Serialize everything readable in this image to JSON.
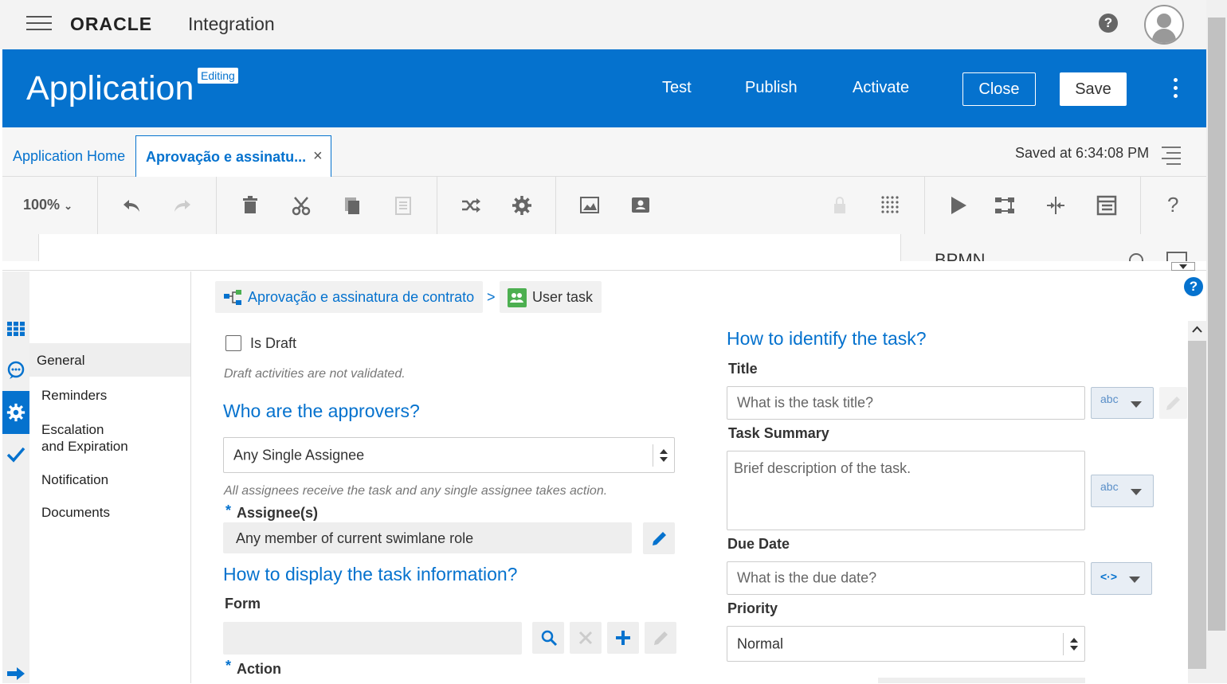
{
  "topbar": {
    "brand": "ORACLE",
    "product": "Integration",
    "help_icon": "help-circle-icon",
    "avatar_icon": "user-avatar-icon"
  },
  "header": {
    "title": "Application",
    "badge": "Editing",
    "actions": {
      "test": "Test",
      "publish": "Publish",
      "activate": "Activate",
      "close": "Close",
      "save": "Save"
    },
    "accent": "#0572ce"
  },
  "tabs": {
    "home": "Application Home",
    "active": "Aprovação e assinatu...",
    "close_glyph": "×",
    "saved_at": "Saved at 6:34:08 PM"
  },
  "toolbar": {
    "zoom": "100%",
    "icons": [
      "undo-icon",
      "redo-icon",
      "delete-icon",
      "cut-icon",
      "copy-icon",
      "paste-icon",
      "shuffle-icon",
      "gear-icon",
      "image-icon",
      "contact-card-icon",
      "lock-icon",
      "grid-icon",
      "play-icon",
      "flow-icon",
      "merge-icon",
      "data-table-icon",
      "help-icon"
    ]
  },
  "canvas": {
    "panel_title": "BPMN"
  },
  "leftnav": {
    "items": [
      "General",
      "Reminders",
      "Escalation",
      "and Expiration",
      "Notification",
      "Documents"
    ]
  },
  "breadcrumb": {
    "process": "Aprovação e assinatura de contrato",
    "separator": ">",
    "activity": "User task"
  },
  "form": {
    "is_draft_label": "Is Draft",
    "is_draft_checked": false,
    "draft_hint": "Draft activities are not validated.",
    "approvers_heading": "Who are the approvers?",
    "approver_type": "Any Single Assignee",
    "approver_hint": "All assignees receive the task and any single assignee takes action.",
    "assignees_label": "Assignee(s)",
    "required_mark": "*",
    "assignees_value": "Any member of current swimlane role",
    "display_heading": "How to display the task information?",
    "form_label": "Form",
    "form_value": "",
    "action_label": "Action"
  },
  "identify": {
    "heading": "How to identify the task?",
    "title_label": "Title",
    "title_placeholder": "What is the task title?",
    "summary_label": "Task Summary",
    "summary_placeholder": "Brief description of the task.",
    "due_label": "Due Date",
    "due_placeholder": "What is the due date?",
    "priority_label": "Priority",
    "priority_value": "Normal",
    "type_abc": "abc",
    "type_expr": "<·>"
  }
}
